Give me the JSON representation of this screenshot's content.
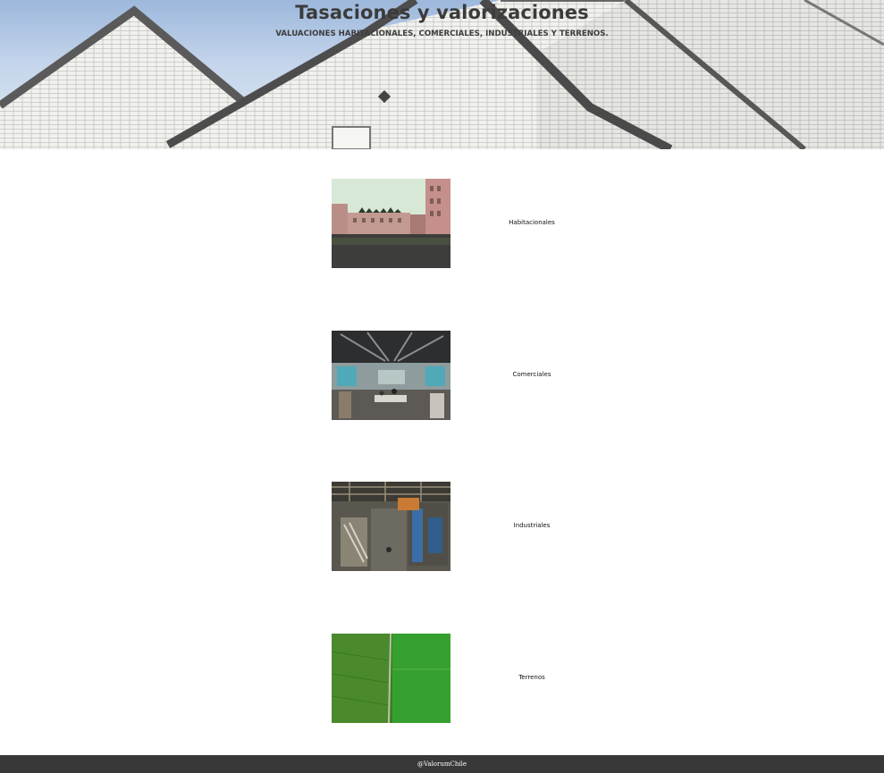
{
  "hero": {
    "title": "Tasaciones y valorizaciones",
    "subtitle": "VALUACIONES HABITACIONALES, COMERCIALES, INDUSTRIALES Y TERRENOS.",
    "background_image": "white-brick-building-facade"
  },
  "categories": [
    {
      "label": "Habitacionales",
      "image": "residential-buildings-courtyard-photo"
    },
    {
      "label": "Comerciales",
      "image": "office-interior-photo"
    },
    {
      "label": "Industriales",
      "image": "warehouse-interior-photo"
    },
    {
      "label": "Terrenos",
      "image": "green-field-aerial-photo"
    }
  ],
  "footer": {
    "text": "@ValorumChile"
  },
  "colors": {
    "footer_bg": "#383838",
    "page_bg": "#ffffff",
    "title_text": "#3b3b3b"
  }
}
